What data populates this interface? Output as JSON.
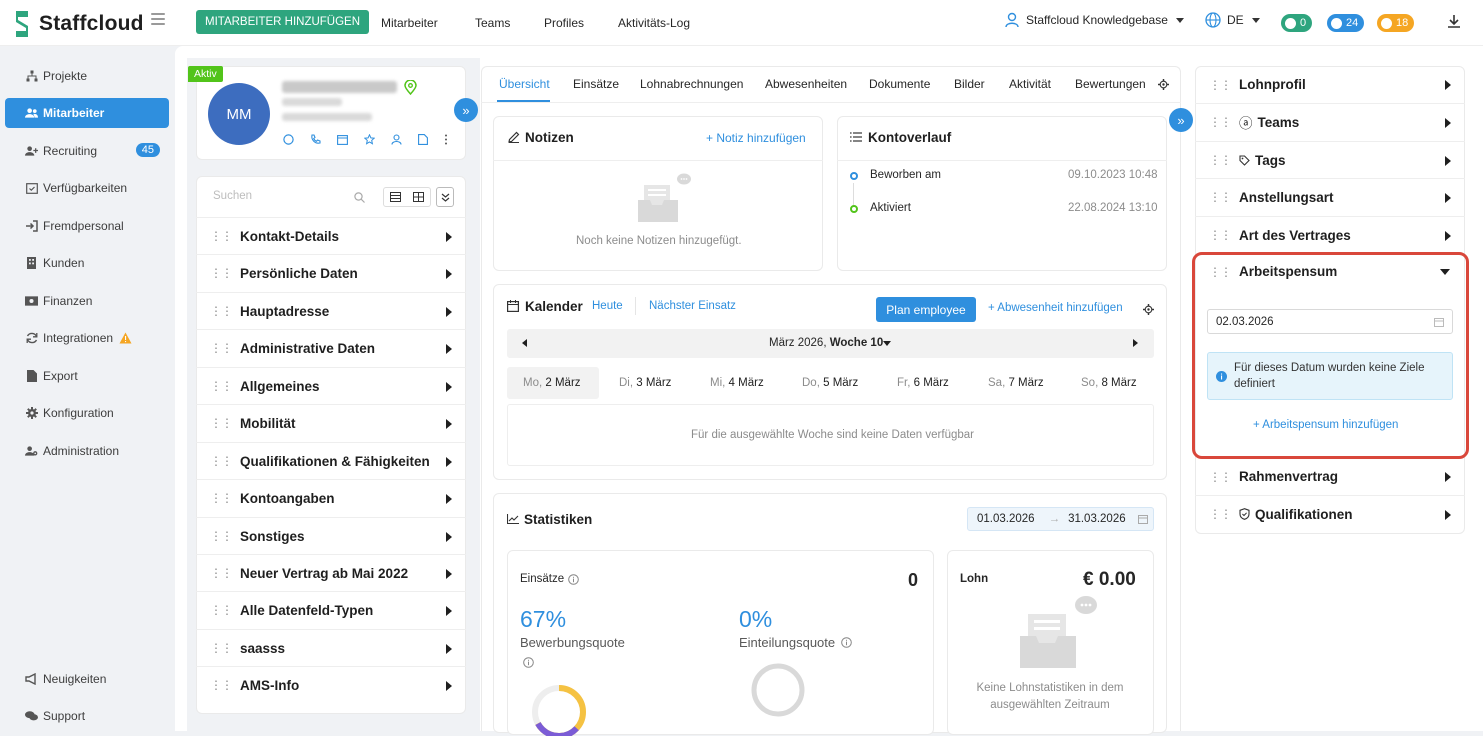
{
  "app": {
    "name": "Staffcloud",
    "brand_color": "#2f8fde",
    "green": "#2ea57e"
  },
  "topbar": {
    "add_button": "MITARBEITER HINZUFÜGEN",
    "nav": [
      "Mitarbeiter",
      "Teams",
      "Profiles",
      "Aktivitäts-Log"
    ],
    "account": "Staffcloud Knowledgebase",
    "language": "DE",
    "counters": [
      {
        "value": "0",
        "color": "#2ea57e"
      },
      {
        "value": "24",
        "color": "#2f8fde"
      },
      {
        "value": "18",
        "color": "#f5a623"
      }
    ]
  },
  "sidebar": {
    "items": [
      {
        "label": "Projekte",
        "icon": "sitemap-icon"
      },
      {
        "label": "Mitarbeiter",
        "icon": "users-icon"
      },
      {
        "label": "Recruiting",
        "icon": "user-plus-icon",
        "badge": "45"
      },
      {
        "label": "Verfügbarkeiten",
        "icon": "calendar-check-icon"
      },
      {
        "label": "Fremdpersonal",
        "icon": "sign-in-icon"
      },
      {
        "label": "Kunden",
        "icon": "building-icon"
      },
      {
        "label": "Finanzen",
        "icon": "money-icon"
      },
      {
        "label": "Integrationen",
        "icon": "sync-icon"
      },
      {
        "label": "Export",
        "icon": "file-icon"
      },
      {
        "label": "Konfiguration",
        "icon": "cog-icon"
      },
      {
        "label": "Administration",
        "icon": "user-cog-icon"
      }
    ],
    "bottom": [
      {
        "label": "Neuigkeiten",
        "icon": "megaphone-icon"
      },
      {
        "label": "Support",
        "icon": "comments-icon"
      }
    ]
  },
  "profile": {
    "status": "Aktiv",
    "initials": "MM",
    "search_placeholder": "Suchen",
    "sections": [
      "Kontakt-Details",
      "Persönliche Daten",
      "Hauptadresse",
      "Administrative Daten",
      "Allgemeines",
      "Mobilität",
      "Qualifikationen & Fähigkeiten",
      "Kontoangaben",
      "Sonstiges",
      "Neuer Vertrag ab Mai 2022",
      "Alle Datenfeld-Typen",
      "saasss",
      "AMS-Info"
    ]
  },
  "tabs": [
    "Übersicht",
    "Einsätze",
    "Lohnabrechnungen",
    "Abwesenheiten",
    "Dokumente",
    "Bilder",
    "Aktivität",
    "Bewertungen"
  ],
  "notes": {
    "title": "Notizen",
    "add": "Notiz hinzufügen",
    "empty": "Noch keine Notizen hinzugefügt."
  },
  "history": {
    "title": "Kontoverlauf",
    "entries": [
      {
        "label": "Beworben am",
        "date": "09.10.2023 10:48",
        "color": "#2f8fde"
      },
      {
        "label": "Aktiviert",
        "date": "22.08.2024 13:10",
        "color": "#52c41a"
      }
    ]
  },
  "calendar": {
    "title": "Kalender",
    "today": "Heute",
    "next": "Nächster Einsatz",
    "plan": "Plan employee",
    "add_absence": "Abwesenheit hinzufügen",
    "month": "März 2026, ",
    "week": "Woche 10",
    "days": [
      {
        "d": "Mo,",
        "n": "2 März"
      },
      {
        "d": "Di,",
        "n": "3 März"
      },
      {
        "d": "Mi,",
        "n": "4 März"
      },
      {
        "d": "Do,",
        "n": "5 März"
      },
      {
        "d": "Fr,",
        "n": "6 März"
      },
      {
        "d": "Sa,",
        "n": "7 März"
      },
      {
        "d": "So,",
        "n": "8 März"
      }
    ],
    "empty": "Für die ausgewählte Woche sind keine Daten verfügbar"
  },
  "stats": {
    "title": "Statistiken",
    "from": "01.03.2026",
    "to": "31.03.2026",
    "einsaetze": "Einsätze",
    "einsaetze_value": "0",
    "rate1": "67%",
    "rate1_label": "Bewerbungsquote",
    "rate1_fraction": 0.67,
    "rate2": "0%",
    "rate2_label": "Einteilungsquote",
    "rate2_fraction": 0,
    "lohn": "Lohn",
    "lohn_value": "€ 0.00",
    "lohn_empty": "Keine Lohnstatistiken in dem ausgewählten Zeitraum"
  },
  "right_panel": {
    "sections_top": [
      "Lohnprofil",
      "Teams",
      "Tags",
      "Anstellungsart",
      "Art des Vertrages"
    ],
    "open": {
      "title": "Arbeitspensum",
      "date": "02.03.2026",
      "info": "Für dieses Datum wurden keine Ziele definiert",
      "add": "Arbeitspensum hinzufügen"
    },
    "sections_bottom": [
      "Rahmenvertrag",
      "Qualifikationen"
    ],
    "highlight_color": "#d9473b"
  }
}
